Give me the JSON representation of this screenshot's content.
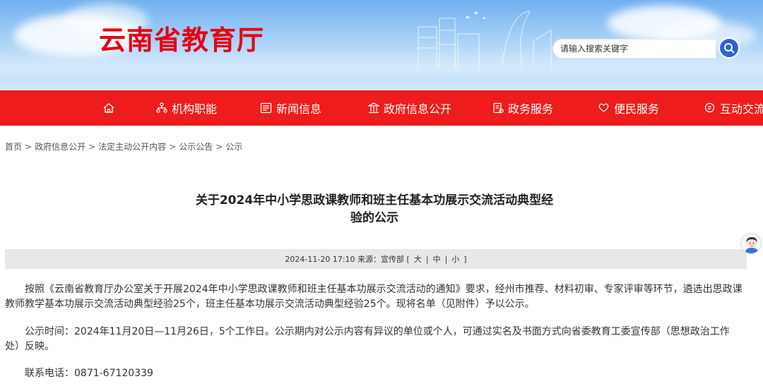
{
  "header": {
    "site_title": "云南省教育厅",
    "search_placeholder": "请输入搜索关键字",
    "search_icon": "search-icon"
  },
  "nav": {
    "items": [
      {
        "label": "",
        "icon": "home-icon"
      },
      {
        "label": "机构职能",
        "icon": "org-icon"
      },
      {
        "label": "新闻信息",
        "icon": "news-icon"
      },
      {
        "label": "政府信息公开",
        "icon": "building-icon"
      },
      {
        "label": "政务服务",
        "icon": "service-icon"
      },
      {
        "label": "便民服务",
        "icon": "heart-hand-icon"
      },
      {
        "label": "互动交流",
        "icon": "chat-icon"
      }
    ]
  },
  "breadcrumb": [
    "首页",
    "政府信息公开",
    "法定主动公开内容",
    "公示公告",
    "公示"
  ],
  "article": {
    "title_line1": "关于2024年中小学思政课教师和班主任基本功展示交流活动典型经",
    "title_line2": "验的公示",
    "meta_text": "2024-11-20 17:10 来源：宣传部 [",
    "size_large": "大",
    "size_mid": "中",
    "size_small": "小",
    "meta_close": "]",
    "p1": "按照《云南省教育厅办公室关于开展2024年中小学思政课教师和班主任基本功展示交流活动的通知》要求，经州市推荐、材料初审、专家评审等环节，遴选出思政课教师教学基本功展示交流活动典型经验25个，班主任基本功展示交流活动典型经验25个。现将名单（见附件）予以公示。",
    "p2": "公示时间：2024年11月20日—11月26日，5个工作日。公示期内对公示内容有异议的单位或个人，可通过实名及书面方式向省委教育工委宣传部（思想政治工作处）反映。",
    "p3": "联系电话：0871-67120339"
  },
  "colors": {
    "brand_red": "#ee1c1c",
    "title_red": "#e60012",
    "search_blue": "#2e64d8"
  }
}
